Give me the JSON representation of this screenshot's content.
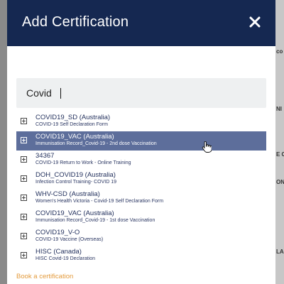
{
  "modal": {
    "title": "Add Certification",
    "close_icon": "close-icon"
  },
  "search": {
    "value": "Covid",
    "placeholder": ""
  },
  "results": [
    {
      "code": "COVID19_SD (Australia)",
      "description": "COVID-19 Self Declaration Form",
      "selected": false
    },
    {
      "code": "COVID19_VAC (Australia)",
      "description": "Immunisation Record_Covid-19 - 2nd dose Vaccination",
      "selected": true
    },
    {
      "code": "34367",
      "description": "COVID-19 Return to Work - Online Training",
      "selected": false
    },
    {
      "code": "DOH_COVID19 (Australia)",
      "description": "Infection Control Training- COVID 19",
      "selected": false
    },
    {
      "code": "WHV-CSD (Australia)",
      "description": "Women's Health Victoria - Covid-19 Self Declaration Form",
      "selected": false
    },
    {
      "code": "COVID19_VAC (Australia)",
      "description": "Immunisation Record_Covid-19 - 1st dose Vaccination",
      "selected": false
    },
    {
      "code": "COVID19_V-O",
      "description": "COVID-19 Vaccine (Overseas)",
      "selected": false
    },
    {
      "code": "HISC (Canada)",
      "description": "HISC Covid-19 Declaration",
      "selected": false
    }
  ],
  "footer": {
    "book_link": "Book a certification"
  },
  "background": {
    "edge_letters": [
      "co",
      "NI",
      "E C",
      "ON",
      "LA"
    ]
  },
  "colors": {
    "header_bg": "#152851",
    "selected_row": "#5d6e9b",
    "link": "#e39a3b"
  }
}
